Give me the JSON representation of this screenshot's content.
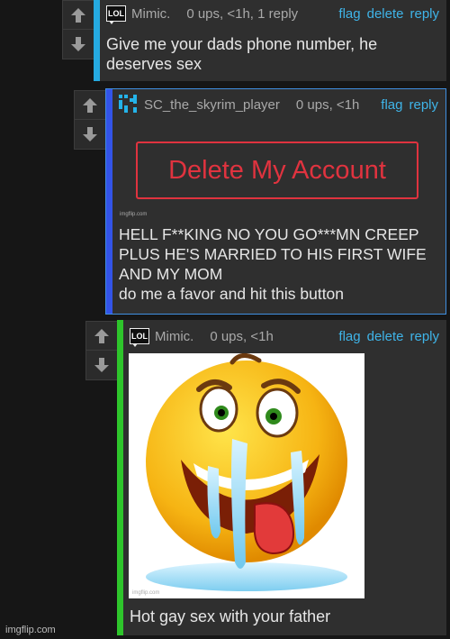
{
  "comments": [
    {
      "username": "Mimic.",
      "meta": "0 ups, <1h, 1 reply",
      "body_lines": [
        "Give me your dads phone number, he",
        "deserves sex"
      ]
    },
    {
      "username": "SC_the_skyrim_player",
      "meta": "0 ups, <1h",
      "button_label": "Delete My Account",
      "image_watermark": "imgflip.com",
      "body_lines": [
        "HELL F**KING NO YOU GO***MN CREEP",
        "PLUS HE'S MARRIED TO HIS FIRST WIFE",
        "AND MY MOM",
        "do me a favor and hit this button"
      ]
    },
    {
      "username": "Mimic.",
      "meta": "0 ups, <1h",
      "image_watermark": "imgflip.com",
      "image_icon": "drooling-emoji-icon",
      "body_lines": [
        "Hot gay sex with your father"
      ]
    }
  ],
  "actions": {
    "flag": "flag",
    "delete": "delete",
    "reply": "reply"
  },
  "lol_badge": "LOL",
  "footer_watermark": "imgflip.com",
  "colors": {
    "bar_cyan": "#25aae1",
    "bar_blue": "#3354e8",
    "bar_green": "#2ec52b",
    "link": "#3fb4e8",
    "danger": "#e0333f"
  }
}
